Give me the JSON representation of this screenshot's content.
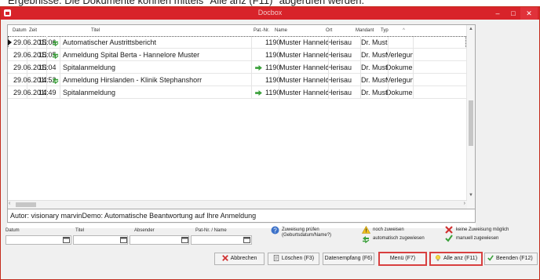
{
  "doc_text": "Ergebnisse. Die Dokumente können mittels \"Alle anz (F11)\" abgerufen werden.",
  "window": {
    "title": "Docbox",
    "min": "–",
    "max": "□",
    "close": "✕"
  },
  "columns": [
    "Datum",
    "Zeit",
    "Titel",
    "Pat.-Nr.",
    "Name",
    "Ort",
    "Mandant",
    "Typ"
  ],
  "rows": [
    {
      "datum": "29.06.2011",
      "zeit": "15:06",
      "icon": "swap-icon",
      "titel": "Automatischer Austrittsbericht",
      "patnr": "1190",
      "name": "Muster Hannelore",
      "ort": "Herisau",
      "mandant": "Dr. Must",
      "typ": ""
    },
    {
      "datum": "29.06.2011",
      "zeit": "15:05",
      "icon": "swap-icon",
      "titel": "Anmeldung Spital Berta - Hannelore Muster",
      "patnr": "1190",
      "name": "Muster Hannelore",
      "ort": "Herisau",
      "mandant": "Dr. Must",
      "typ": "Verlegun"
    },
    {
      "datum": "29.06.2011",
      "zeit": "15:04",
      "icon": "",
      "titel": "Spitalanmeldung",
      "patnr": "1190",
      "name": "Muster Hannelore",
      "ort": "Herisau",
      "mandant": "Dr. Must",
      "typ": "Dokumer"
    },
    {
      "datum": "29.06.2011",
      "zeit": "14:52",
      "icon": "swap-icon",
      "titel": "Anmeldung Hirslanden - Klinik Stephanshorr",
      "patnr": "1190",
      "name": "Muster Hannelore",
      "ort": "Herisau",
      "mandant": "Dr. Must",
      "typ": "Verlegun"
    },
    {
      "datum": "29.06.2011",
      "zeit": "14:49",
      "icon": "",
      "titel": "Spitalanmeldung",
      "patnr": "1190",
      "name": "Muster Hannelore",
      "ort": "Herisau",
      "mandant": "Dr. Must",
      "typ": "Dokumer"
    }
  ],
  "info_text": "Autor: visionary marvinDemo: Automatische Beantwortung auf Ihre Anmeldung",
  "filter": {
    "datum": "Datum",
    "titel": "Titel",
    "absender": "Absender",
    "patnr": "Pat-Nr. / Name"
  },
  "legend": {
    "pruefen_1": "Zuweisung prüfen",
    "pruefen_2": "(Geburtsdatum/Name?)",
    "noch": "noch zuweisen",
    "auto": "automatisch zugewiesen",
    "keine": "keine Zuweisung möglich",
    "manuell": "manuell zugewiesen"
  },
  "buttons": {
    "abbrechen": "Abbrechen",
    "loeschen": "Löschen (F3)",
    "datenempfang": "Datenempfang (F6)",
    "menu": "Menü (F7)",
    "alle": "Alle anz (F11)",
    "beenden": "Beenden (F12)"
  },
  "colors": {
    "title_red": "#d8232a",
    "accent_green": "#3aa03a",
    "warning_yellow": "#f0c020",
    "error_red": "#d03030"
  }
}
